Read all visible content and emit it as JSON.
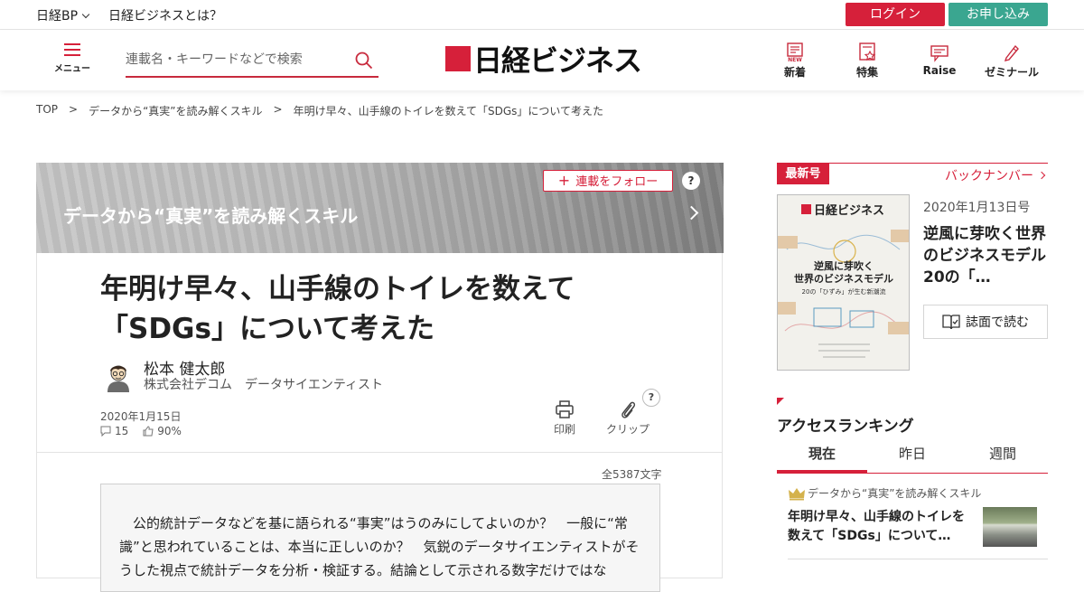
{
  "topbar": {
    "nikkei_bp": "日経BP",
    "about": "日経ビジネスとは？",
    "login": "ログイン",
    "apply": "お申し込み"
  },
  "header": {
    "menu_label": "メニュー",
    "search_placeholder": "連載名・キーワードなどで検索",
    "logo_text": "日経ビジネス",
    "nav": [
      {
        "label": "新着",
        "icon": "new-icon"
      },
      {
        "label": "特集",
        "icon": "feature-icon"
      },
      {
        "label": "Raise",
        "icon": "raise-icon"
      },
      {
        "label": "ゼミナール",
        "icon": "seminar-icon"
      }
    ],
    "accent_color": "#d6203a"
  },
  "breadcrumb": {
    "items": [
      "TOP",
      "データから“真実”を読み解くスキル",
      "年明け早々、山手線のトイレを数えて「SDGs」について考えた"
    ],
    "separator": ">"
  },
  "article": {
    "series_name": "データから“真実”を読み解くスキル",
    "follow_label": "連載をフォロー",
    "help": "?",
    "title_line1": "年明け早々、山手線のトイレを数えて",
    "title_line2": "「SDGs」について考えた",
    "author": "松本 健太郎",
    "affiliation": "株式会社デコム　データサイエンティスト",
    "date": "2020年1月15日",
    "comments": "15",
    "likes": "90%",
    "print_label": "印刷",
    "clip_label": "クリップ",
    "char_count": "全5387文字",
    "lead": "公的統計データなどを基に語られる“事実”はうのみにしてよいのか？　一般に“常識”と思われていることは、本当に正しいのか？　気鋭のデータサイエンティストがそうした視点で統計データを分析・検証する。結論として示される数字だけではな"
  },
  "sidebar": {
    "latest_tag": "最新号",
    "back_numbers": "バックナンバー",
    "cover_logo": "日経ビジネス",
    "cover_headline1": "逆風に芽吹く",
    "cover_headline2": "世界のビジネスモデル",
    "cover_sub": "20の「ひずみ」が生む新潮流",
    "issue_date": "2020年1月13日号",
    "issue_title": "逆風に芽吹く世界のビジネスモデル　20の「…",
    "read_label": "誌面で読む",
    "ranking_title": "アクセスランキング",
    "tabs": [
      "現在",
      "昨日",
      "週間"
    ],
    "rank1_series": "データから“真実”を読み解くスキル",
    "rank1_title": "年明け早々、山手線のトイレを数えて「SDGs」について…"
  }
}
